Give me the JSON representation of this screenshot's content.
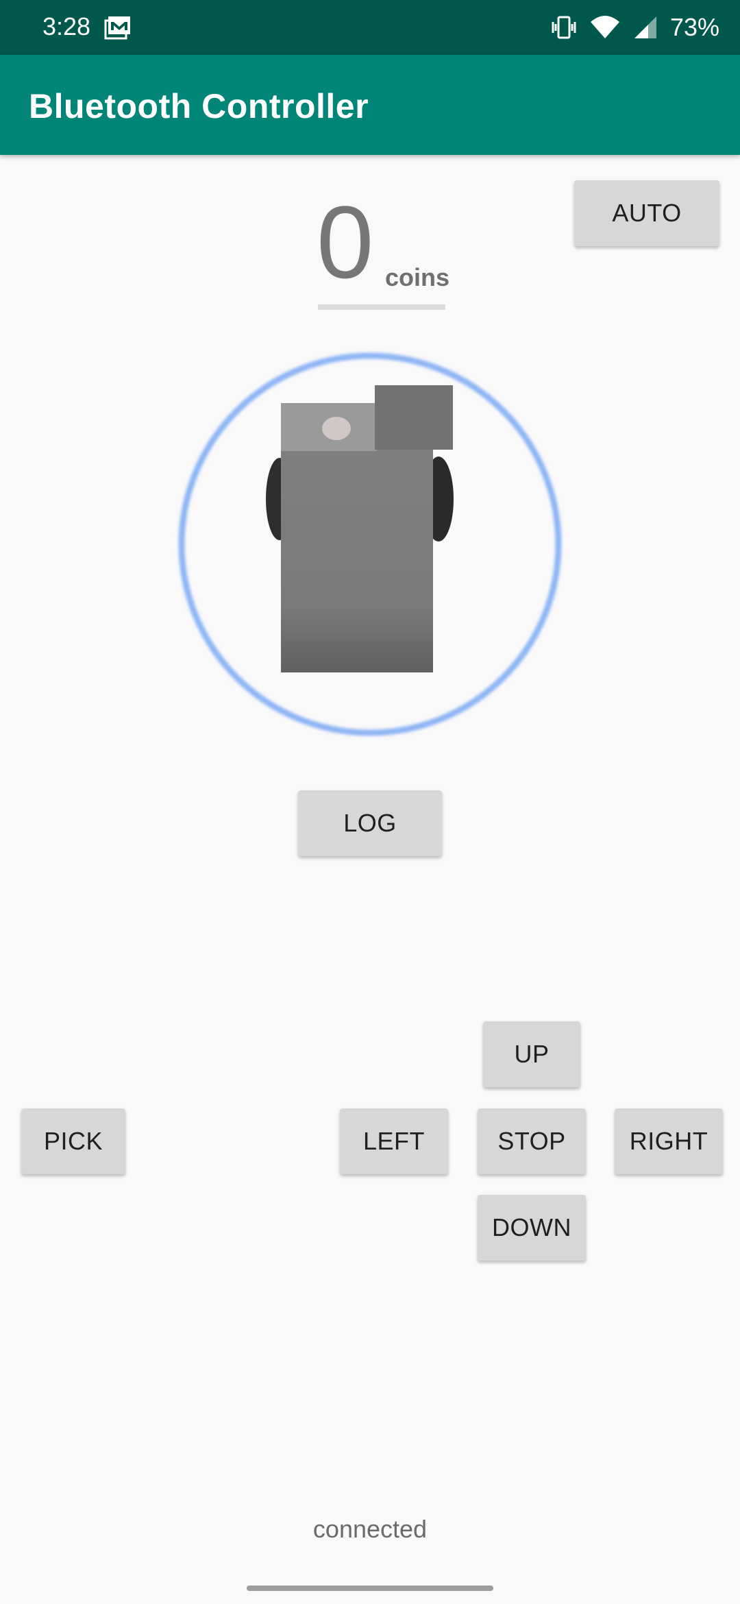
{
  "status_bar": {
    "time": "3:28",
    "battery": "73%",
    "icons": [
      "mail-icon",
      "vibrate-icon",
      "wifi-icon",
      "signal-icon"
    ]
  },
  "app_bar": {
    "title": "Bluetooth Controller"
  },
  "coins": {
    "value": "0",
    "label": "coins"
  },
  "buttons": {
    "auto": "AUTO",
    "log": "LOG",
    "up": "UP",
    "pick": "PICK",
    "left": "LEFT",
    "stop": "STOP",
    "right": "RIGHT",
    "down": "DOWN"
  },
  "connection_status": "connected",
  "colors": {
    "status_bar": "#00574b",
    "app_bar": "#008577",
    "button": "#d6d7d7",
    "ring": "#8fb5f5"
  }
}
